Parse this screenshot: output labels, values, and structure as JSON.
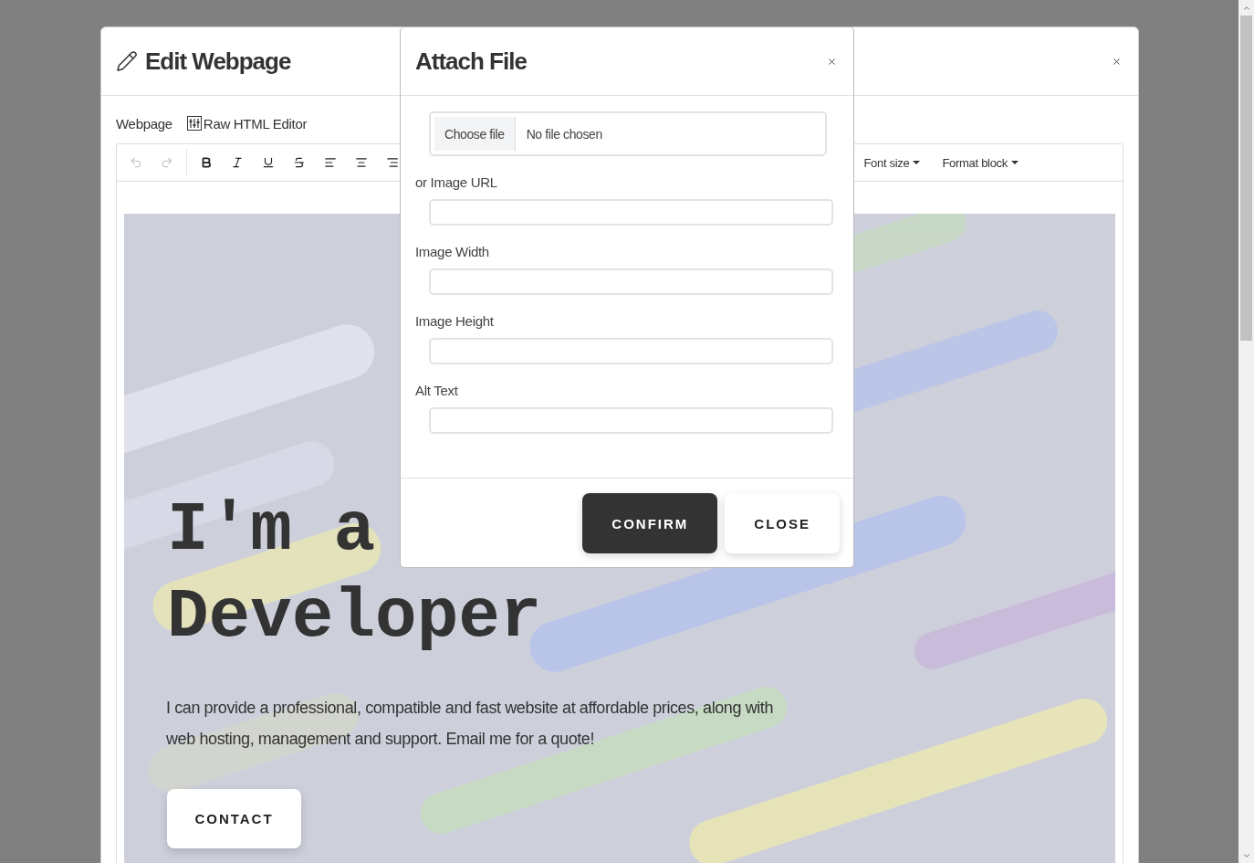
{
  "editor_dialog": {
    "title": "Edit Webpage",
    "view_links": [
      {
        "label": "Webpage",
        "kind": "plain"
      },
      {
        "label": "Raw HTML Editor",
        "kind": "html"
      }
    ],
    "toolbar": [
      {
        "kind": "undo",
        "disabled": true
      },
      {
        "kind": "redo",
        "disabled": true
      },
      {
        "kind": "bold",
        "disabled": false
      },
      {
        "kind": "italic",
        "disabled": false
      },
      {
        "kind": "underline",
        "disabled": false
      },
      {
        "kind": "strike",
        "disabled": false
      },
      {
        "kind": "align-left",
        "disabled": false
      },
      {
        "kind": "align-center",
        "disabled": false
      },
      {
        "kind": "align-right"
      }
    ],
    "dropdowns": [
      "Font size",
      "Format block"
    ],
    "hero": {
      "heading_lines": [
        "I'm a",
        "Developer"
      ],
      "paragraph": "I can provide a professional, compatible and fast website at affordable prices, along with web hosting, management and support. Email me for a quote!",
      "button": "CONTACT"
    }
  },
  "attach_dialog": {
    "title": "Attach File",
    "file_input": {
      "button": "Choose file",
      "status": "No file chosen"
    },
    "fields": [
      {
        "label": "or Image URL"
      },
      {
        "label": "Image Width"
      },
      {
        "label": "Image Height"
      },
      {
        "label": "Alt Text"
      }
    ],
    "buttons": [
      {
        "label": "CONFIRM",
        "kind": "primary"
      },
      {
        "label": "CLOSE",
        "kind": "secondary"
      }
    ]
  }
}
